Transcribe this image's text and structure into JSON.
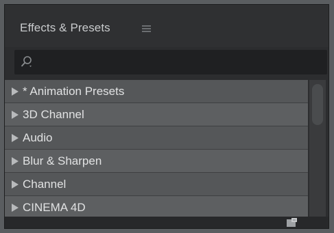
{
  "panel": {
    "title": "Effects & Presets",
    "menu_icon": "hamburger-menu-icon"
  },
  "search": {
    "value": "",
    "placeholder": "",
    "icon": "search-icon"
  },
  "list": {
    "items": [
      {
        "label": "* Animation Presets"
      },
      {
        "label": "3D Channel"
      },
      {
        "label": "Audio"
      },
      {
        "label": "Blur & Sharpen"
      },
      {
        "label": "Channel"
      },
      {
        "label": "CINEMA 4D"
      }
    ]
  },
  "footer": {
    "icon": "new-folder-icon"
  },
  "colors": {
    "panel_bg": "#2c2d2f",
    "row_bg": "#555759",
    "text": "#e1e2e3"
  }
}
